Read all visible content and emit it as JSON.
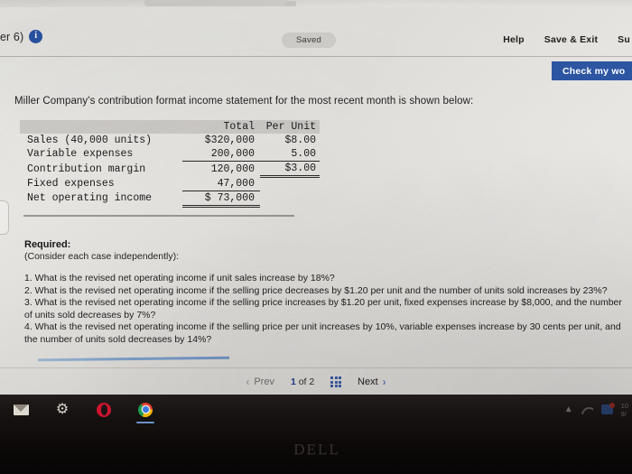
{
  "header": {
    "assignment_label": "er 6)",
    "info_icon": "info-icon",
    "saved_label": "Saved",
    "links": [
      {
        "label": "Help"
      },
      {
        "label": "Save & Exit"
      },
      {
        "label": "Su"
      }
    ],
    "check_button_label": "Check my wo"
  },
  "question": {
    "intro": "Miller Company's contribution format income statement for the most recent month is shown below:",
    "required_heading": "Required:",
    "required_sub": "(Consider each case independently):",
    "items": [
      "1. What is the revised net operating income if unit sales increase by 18%?",
      "2. What is the revised net operating income if the selling price decreases by $1.20 per unit and the number of units sold increases by 23%?",
      "3. What is the revised net operating income if the selling price increases by $1.20 per unit, fixed expenses increase by $8,000, and the number of units sold decreases by 7%?",
      "4. What is the revised net operating income if the selling price per unit increases by 10%, variable expenses increase by 30 cents per unit, and the number of units sold decreases by 14%?"
    ]
  },
  "statement": {
    "columns": [
      "",
      "Total",
      "Per Unit"
    ],
    "rows": [
      {
        "label": "Sales (40,000 units)",
        "total": "$320,000",
        "unit": "$8.00"
      },
      {
        "label": "Variable expenses",
        "total": "200,000",
        "unit": "5.00"
      },
      {
        "label": "Contribution margin",
        "total": "120,000",
        "unit": "$3.00"
      },
      {
        "label": "Fixed expenses",
        "total": "47,000",
        "unit": ""
      },
      {
        "label": "Net operating income",
        "total": "$ 73,000",
        "unit": ""
      }
    ]
  },
  "pager": {
    "prev_label": "Prev",
    "next_label": "Next",
    "page_current": "1",
    "page_of": "of",
    "page_total": "2",
    "grid_icon": "grid-menu-icon"
  },
  "taskbar": {
    "items": [
      {
        "icon": "mail-icon"
      },
      {
        "icon": "gear-icon"
      },
      {
        "icon": "opera-icon"
      },
      {
        "icon": "chrome-icon"
      }
    ],
    "tray": {
      "chevron_icon": "chevron-up-icon",
      "wifi_icon": "wifi-icon",
      "notification_icon": "action-center-icon",
      "clock": "10\n9/"
    }
  },
  "monitor": {
    "brand": "DELL"
  },
  "colors": {
    "accent_blue": "#2c55a2",
    "link_blue": "#3a5ba3",
    "screen_bg": "#e9e8e4",
    "taskbar": "#181413"
  }
}
